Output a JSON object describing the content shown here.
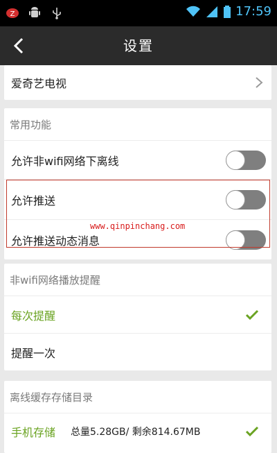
{
  "status_bar": {
    "time": "17:59",
    "icons": [
      "antivirus-icon",
      "android-icon",
      "usb-icon",
      "wifi-icon",
      "signal-icon",
      "battery-icon"
    ]
  },
  "toolbar": {
    "title": "设置",
    "back_icon": "back-chevron-icon"
  },
  "account": {
    "label": "爱奇艺电视"
  },
  "common": {
    "header": "常用功能",
    "items": [
      {
        "label": "允许非wifi网络下离线",
        "enabled": false
      },
      {
        "label": "允许推送",
        "enabled": false
      },
      {
        "label": "允许推送动态消息",
        "enabled": false
      }
    ]
  },
  "watermark": "www.qinpinchang.com",
  "non_wifi": {
    "header": "非wifi网络播放提醒",
    "options": [
      {
        "label": "每次提醒",
        "selected": true
      },
      {
        "label": "提醒一次",
        "selected": false
      }
    ]
  },
  "storage": {
    "header": "离线缓存存储目录",
    "option": {
      "label": "手机存储",
      "detail": "总量5.28GB/ 剩余814.67MB",
      "selected": true
    }
  },
  "colors": {
    "accent_green": "#6aa321",
    "toggle_off": "#7f7f7f",
    "toolbar": "#2b2b2b",
    "highlight": "#c0392b"
  }
}
